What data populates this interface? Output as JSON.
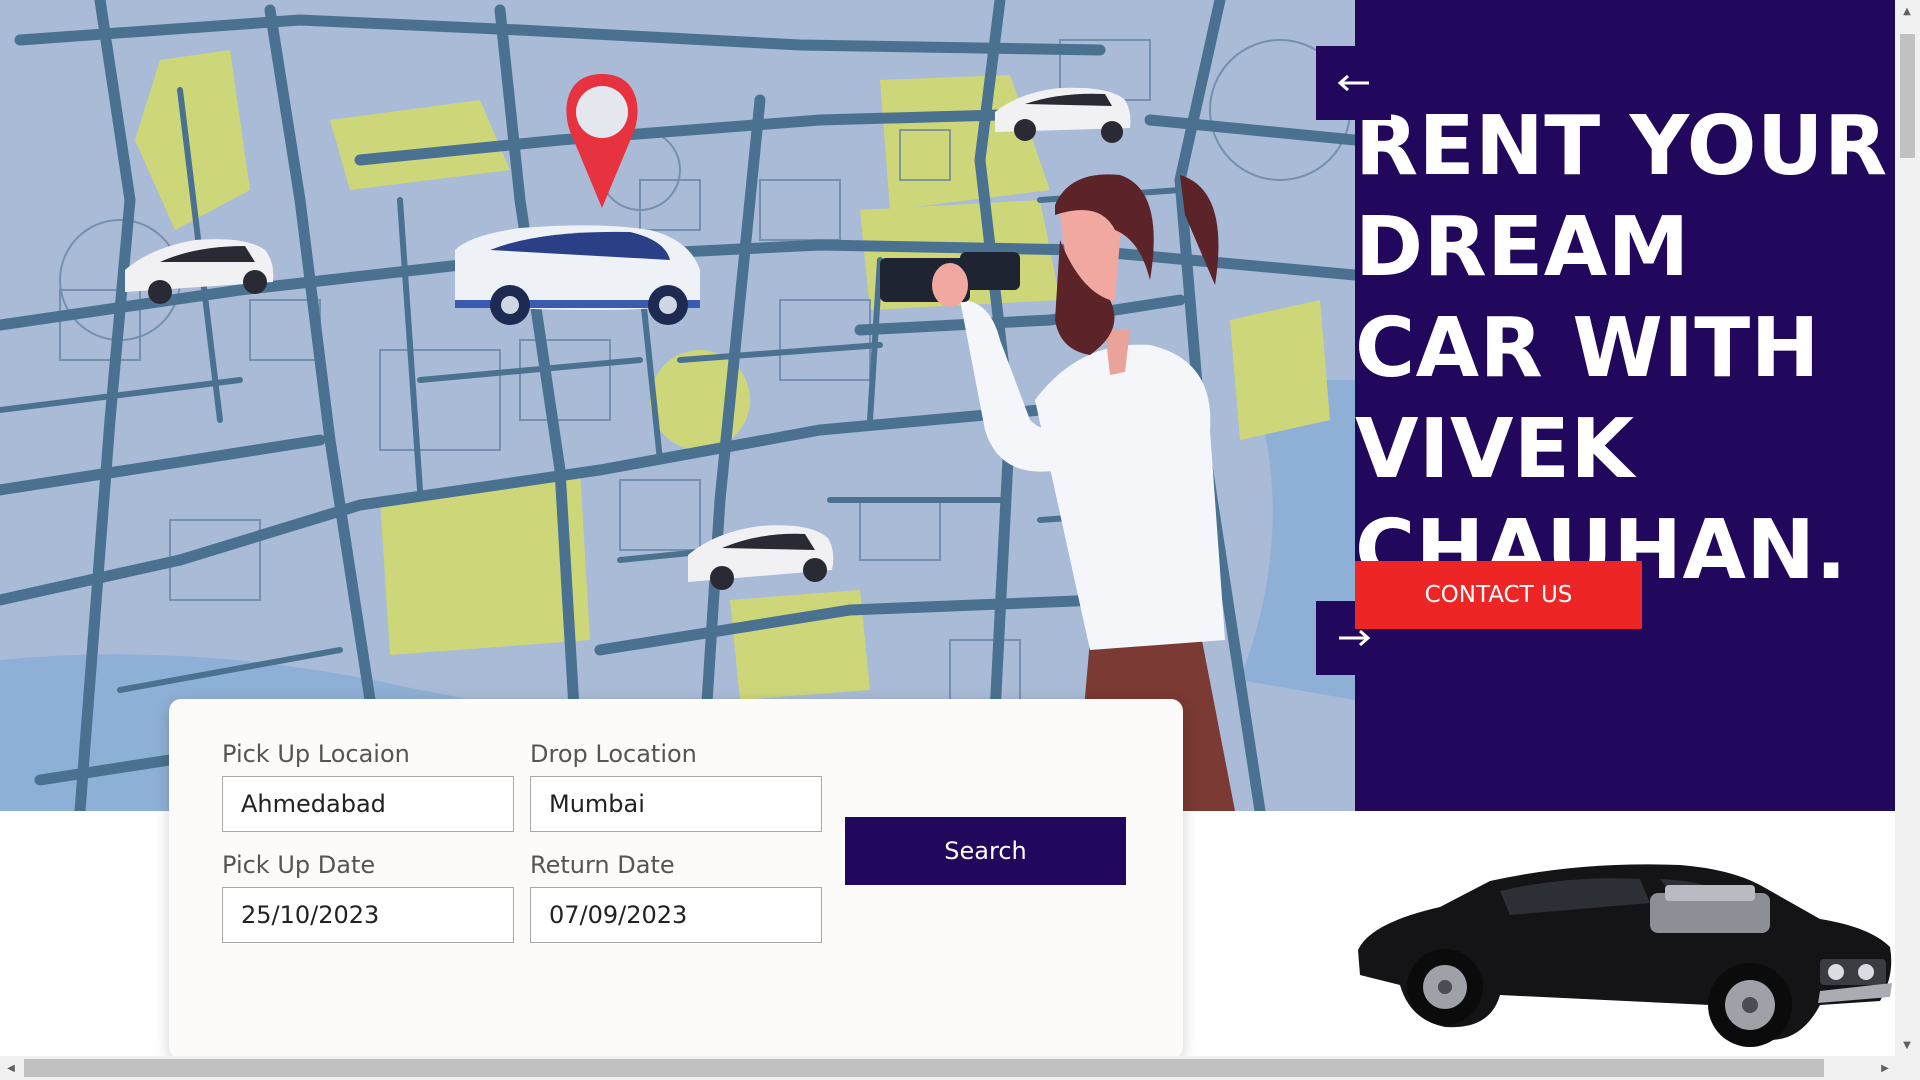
{
  "hero": {
    "headline": "RENT YOUR DREAM CAR WITH VIVEK CHAUHAN.",
    "contact_label": "CONTACT US",
    "prev_icon": "arrow-left-icon",
    "next_icon": "arrow-right-icon",
    "illustration": "city-map-illustration"
  },
  "search_form": {
    "pickup_location": {
      "label": "Pick Up Locaion",
      "value": "Ahmedabad"
    },
    "drop_location": {
      "label": "Drop Location",
      "value": "Mumbai"
    },
    "pickup_date": {
      "label": "Pick Up Date",
      "value": "25/10/2023"
    },
    "return_date": {
      "label": "Return Date",
      "value": "07/09/2023"
    },
    "search_label": "Search"
  },
  "colors": {
    "brand_dark": "#22085c",
    "accent_red": "#ee2525",
    "map_background": "#a9bbd6",
    "card_background": "#fdfbf9"
  }
}
